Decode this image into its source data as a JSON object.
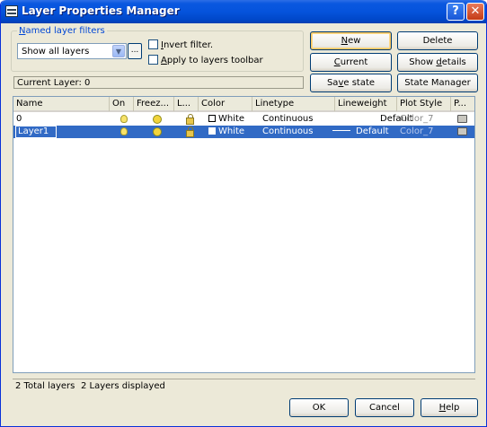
{
  "window": {
    "title": "Layer Properties Manager",
    "help": "?",
    "close": "✕"
  },
  "filters": {
    "legend_pre": "",
    "legend_ul": "N",
    "legend_post": "amed layer filters",
    "combo_value": "Show all layers",
    "dots": "...",
    "invert_ul": "I",
    "invert_post": "nvert filter.",
    "apply_pre": "",
    "apply_ul": "A",
    "apply_post": "pply to layers toolbar"
  },
  "buttons": {
    "new_ul": "N",
    "new_post": "ew",
    "delete": "Delete",
    "current_ul": "C",
    "current_post": "urrent",
    "show_pre": "Show ",
    "show_ul": "d",
    "show_post": "etails",
    "save_pre": "Sa",
    "save_ul": "v",
    "save_post": "e state",
    "state_mgr": "State Manager",
    "ok": "OK",
    "cancel": "Cancel",
    "help_ul": "H",
    "help_post": "elp"
  },
  "current_layer": "Current Layer:  0",
  "columns": [
    "Name",
    "On",
    "Freez...",
    "L...",
    "Color",
    "Linetype",
    "Lineweight",
    "Plot Style",
    "P..."
  ],
  "rows": [
    {
      "name": "0",
      "color": "White",
      "linetype": "Continuous",
      "lineweight": "Default",
      "plotstyle": "Color_7"
    },
    {
      "name": "Layer1",
      "color": "White",
      "linetype": "Continuous",
      "lineweight": "Default",
      "plotstyle": "Color_7"
    }
  ],
  "status": {
    "total": "2 Total layers",
    "displayed": "2 Layers displayed"
  },
  "icons": {
    "on": "lightbulb-icon",
    "freeze": "sun-icon",
    "lock": "padlock-icon",
    "plot": "printer-icon"
  },
  "colors": {
    "titlebar": "#0553dc",
    "selection": "#316ac5",
    "dialog": "#ece9d8"
  }
}
